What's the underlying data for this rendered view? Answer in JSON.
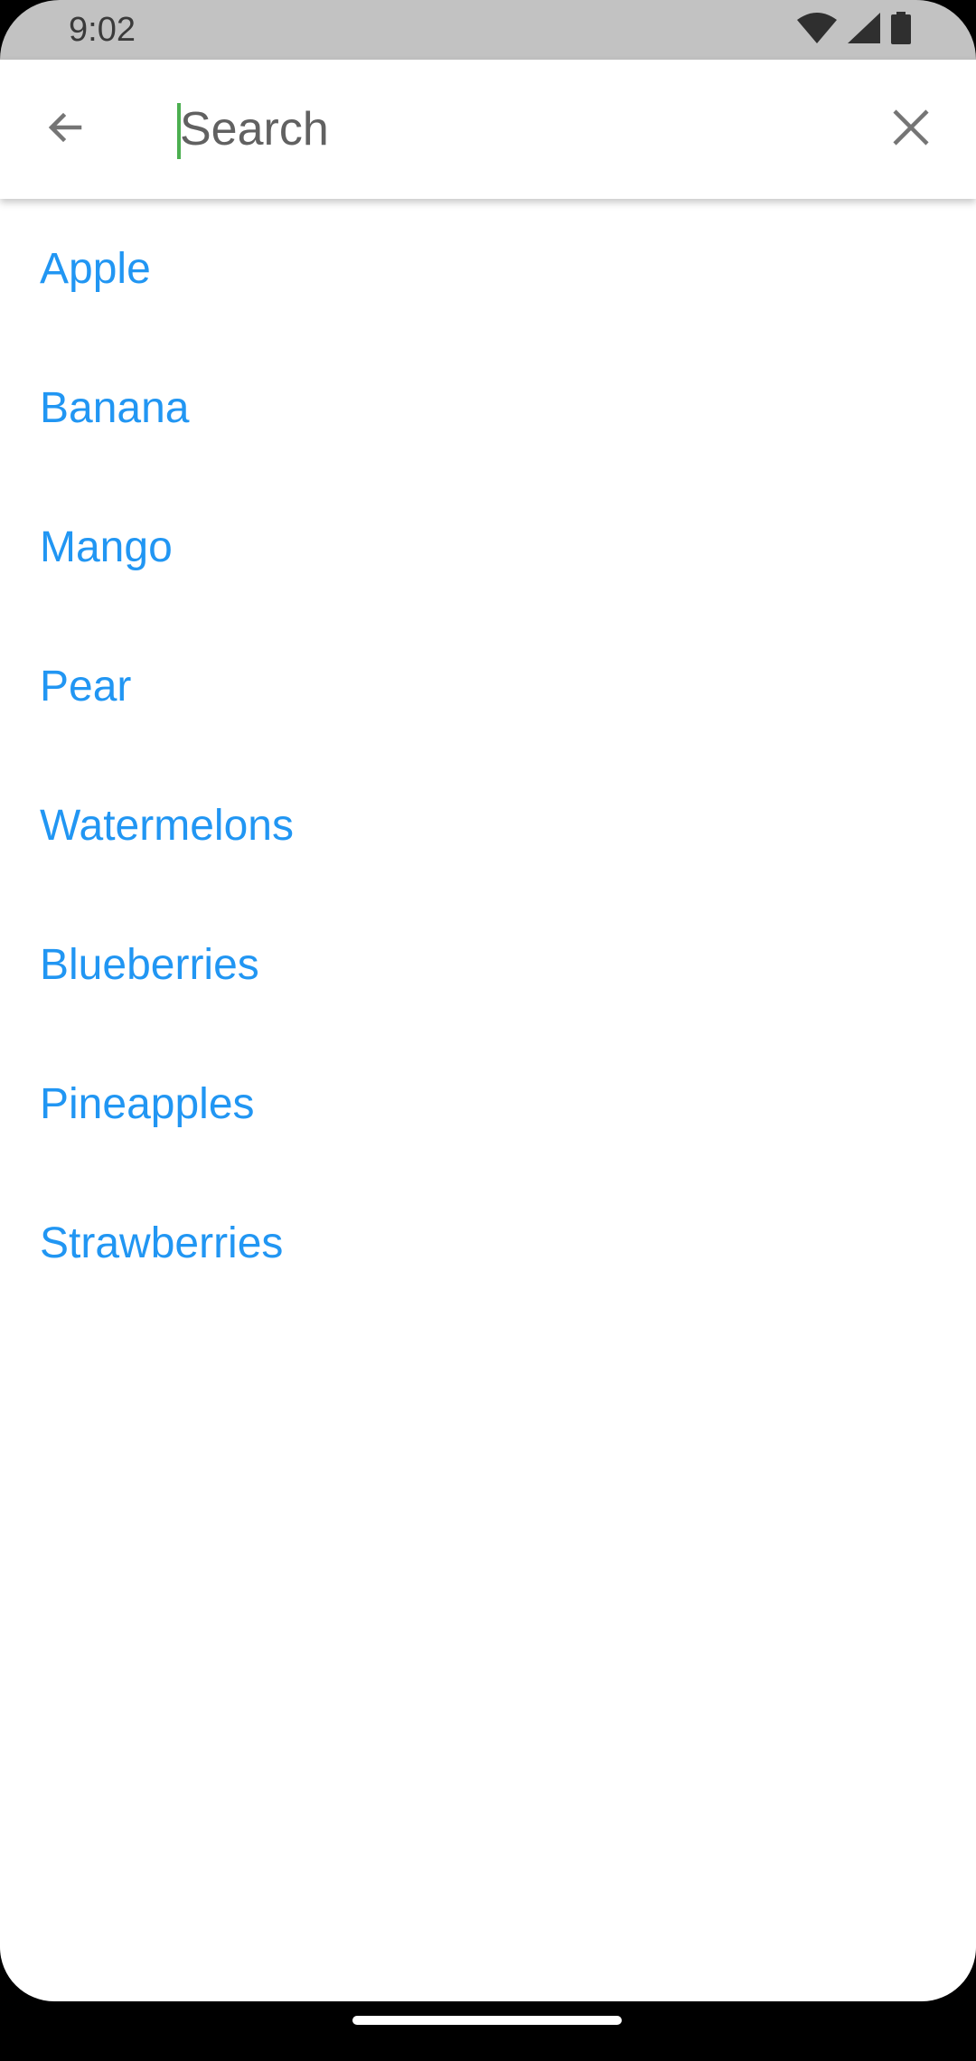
{
  "status_bar": {
    "time": "9:02",
    "icons": [
      "wifi-icon",
      "cell-signal-icon",
      "battery-icon"
    ]
  },
  "search_bar": {
    "back_icon": "arrow-back-icon",
    "placeholder": "Search",
    "value": "",
    "clear_icon": "close-icon"
  },
  "results": [
    "Apple",
    "Banana",
    "Mango",
    "Pear",
    "Watermelons",
    "Blueberries",
    "Pineapples",
    "Strawberries"
  ],
  "colors": {
    "item_text": "#2196f3",
    "caret": "#4caf50",
    "status_bar": "#c2c2c2",
    "icon": "#757575"
  }
}
